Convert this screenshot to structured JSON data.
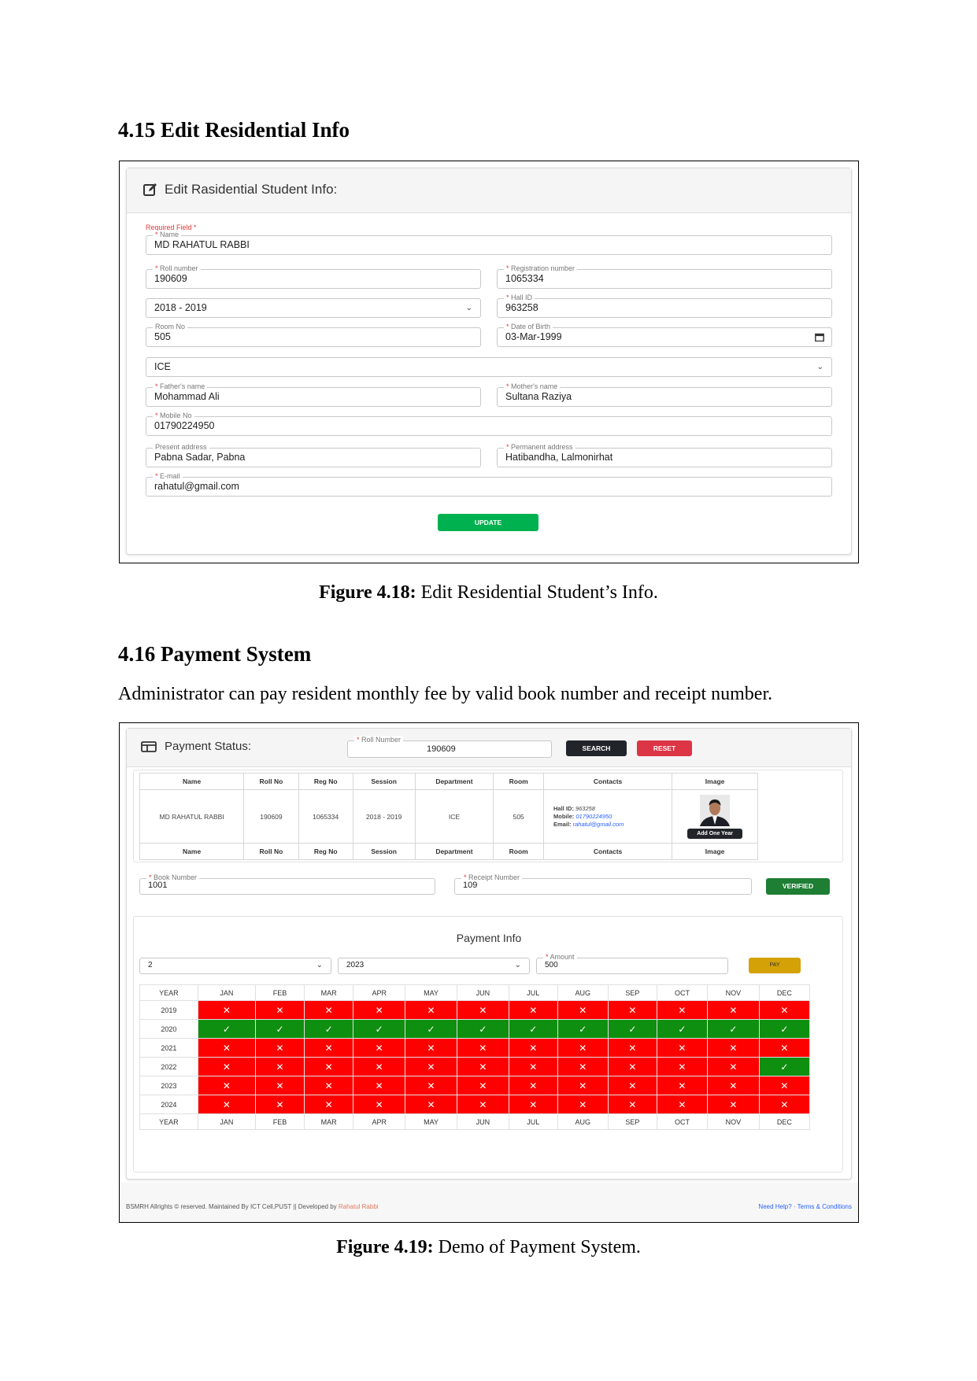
{
  "section1": {
    "heading": "4.15 Edit Residential Info"
  },
  "edit_form": {
    "icon": "edit-icon",
    "title": "Edit Rasidential Student Info:",
    "required_note": "Required Field *",
    "name_label": "Name",
    "name_value": "MD RAHATUL RABBI",
    "roll_label": "Roll number",
    "roll_value": "190609",
    "reg_label": "Registration number",
    "reg_value": "1065334",
    "session_value": "2018 - 2019",
    "hall_label": "Hall ID",
    "hall_value": "963258",
    "room_label": "Room No",
    "room_value": "505",
    "dob_label": "Date of Birth",
    "dob_value": "03-Mar-1999",
    "dept_value": "ICE",
    "father_label": "Father's name",
    "father_value": "Mohammad Ali",
    "mother_label": "Mother's name",
    "mother_value": "Sultana Raziya",
    "mobile_label": "Mobile No",
    "mobile_value": "01790224950",
    "present_label": "Present address",
    "present_value": "Pabna Sadar, Pabna",
    "permanent_label": "Permanent address",
    "permanent_value": "Hatibandha, Lalmonirhat",
    "email_label": "E-mail",
    "email_value": "rahatul@gmail.com",
    "update_label": "UPDATE",
    "accent_green": "#00b14f"
  },
  "caption1": {
    "bold": "Figure 4.18:",
    "text": " Edit Residential Student’s Info."
  },
  "section2": {
    "heading": "4.16 Payment System",
    "paragraph": "Administrator can pay resident monthly fee by valid book number and receipt number."
  },
  "payment": {
    "icon": "table-icon",
    "title": "Payment Status:",
    "roll_label": "Roll Number",
    "roll_value": "190609",
    "search_label": "SEARCH",
    "reset_label": "RESET",
    "table_headers": [
      "Name",
      "Roll No",
      "Reg No",
      "Session",
      "Department",
      "Room",
      "Contacts",
      "Image"
    ],
    "student": {
      "name": "MD RAHATUL RABBI",
      "roll": "190609",
      "reg": "1065334",
      "session": "2018 - 2019",
      "department": "ICE",
      "room": "505",
      "hall_id_label": "Hall ID:",
      "hall_id": "963258",
      "mobile_label": "Mobile:",
      "mobile": "01790224950",
      "email_label": "Email:",
      "email": "rahatul@gmail.com",
      "add_year_label": "Add One Year"
    },
    "book_label": "Book Number",
    "book_value": "1001",
    "receipt_label": "Receipt Number",
    "receipt_value": "109",
    "verified_label": "VERIFIED",
    "info_title": "Payment Info",
    "month_select": "2",
    "year_select": "2023",
    "amount_label": "Amount",
    "amount_value": "500",
    "pay_label": "PAY",
    "months": [
      "JAN",
      "FEB",
      "MAR",
      "APR",
      "MAY",
      "JUN",
      "JUL",
      "AUG",
      "SEP",
      "OCT",
      "NOV",
      "DEC"
    ],
    "year_header": "YEAR",
    "rows": [
      {
        "year": "2019",
        "paid": [
          0,
          0,
          0,
          0,
          0,
          0,
          0,
          0,
          0,
          0,
          0,
          0
        ]
      },
      {
        "year": "2020",
        "paid": [
          1,
          1,
          1,
          1,
          1,
          1,
          1,
          1,
          1,
          1,
          1,
          1
        ]
      },
      {
        "year": "2021",
        "paid": [
          0,
          0,
          0,
          0,
          0,
          0,
          0,
          0,
          0,
          0,
          0,
          0
        ]
      },
      {
        "year": "2022",
        "paid": [
          0,
          0,
          0,
          0,
          0,
          0,
          0,
          0,
          0,
          0,
          0,
          1
        ]
      },
      {
        "year": "2023",
        "paid": [
          0,
          0,
          0,
          0,
          0,
          0,
          0,
          0,
          0,
          0,
          0,
          0
        ]
      },
      {
        "year": "2024",
        "paid": [
          0,
          0,
          0,
          0,
          0,
          0,
          0,
          0,
          0,
          0,
          0,
          0
        ]
      }
    ],
    "paid_color": "#0f8f0f",
    "unpaid_color": "#ff0000",
    "footer_left": "BSMRH Allrights © reserved. Maintained By ICT Cell,PUST || Developed by ",
    "footer_dev": "Rahatul Rabbi",
    "footer_help": "Need Help?",
    "footer_sep": " · ",
    "footer_terms": "Terms & Conditions"
  },
  "caption2": {
    "bold": "Figure 4.19:",
    "text": " Demo of Payment System."
  }
}
